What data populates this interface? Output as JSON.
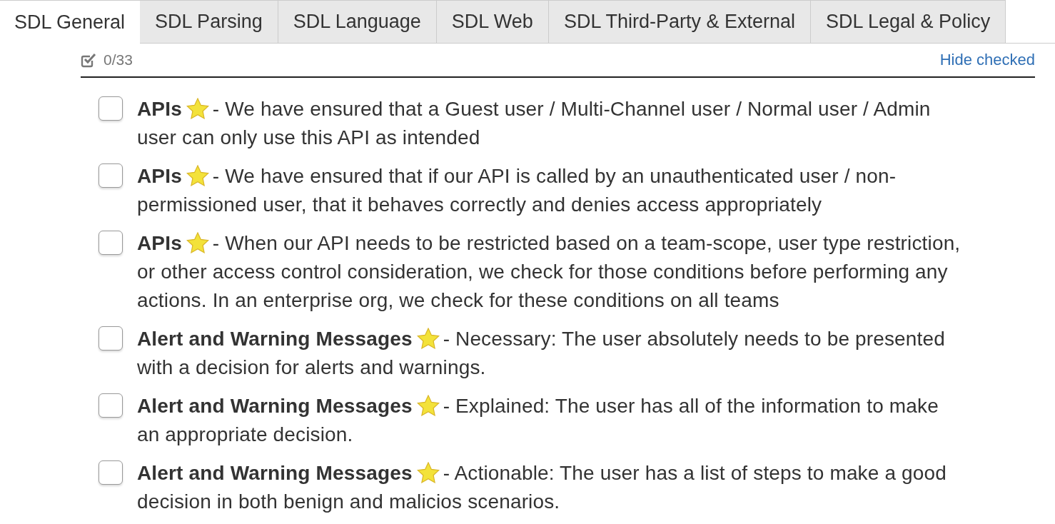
{
  "tabs": [
    {
      "label": "SDL General",
      "selected": true
    },
    {
      "label": "SDL Parsing",
      "selected": false
    },
    {
      "label": "SDL Language",
      "selected": false
    },
    {
      "label": "SDL Web",
      "selected": false
    },
    {
      "label": "SDL Third-Party & External",
      "selected": false
    },
    {
      "label": "SDL Legal & Policy",
      "selected": false
    }
  ],
  "progress": {
    "count": "0/33",
    "link": "Hide checked"
  },
  "items": [
    {
      "checked": false,
      "title": "APIs",
      "starred": true,
      "text": "- We have ensured that a Guest user / Multi-Channel user / Normal user / Admin user can only use this API as intended"
    },
    {
      "checked": false,
      "title": "APIs",
      "starred": true,
      "text": "- We have ensured that if our API is called by an unauthenticated user / non-permissioned user, that it behaves correctly and denies access appropriately"
    },
    {
      "checked": false,
      "title": "APIs",
      "starred": true,
      "text": "- When our API needs to be restricted based on a team-scope, user type restriction, or other access control consideration, we check for those conditions before performing any actions. In an enterprise org, we check for these conditions on all teams"
    },
    {
      "checked": false,
      "title": "Alert and Warning Messages",
      "starred": true,
      "text": "- Necessary: The user absolutely needs to be presented with a decision for alerts and warnings."
    },
    {
      "checked": false,
      "title": "Alert and Warning Messages",
      "starred": true,
      "text": "- Explained: The user has all of the information to make an appropriate decision."
    },
    {
      "checked": false,
      "title": "Alert and Warning Messages",
      "starred": true,
      "text": "- Actionable: The user has a list of steps to make a good decision in both benign and malicios scenarios."
    }
  ]
}
